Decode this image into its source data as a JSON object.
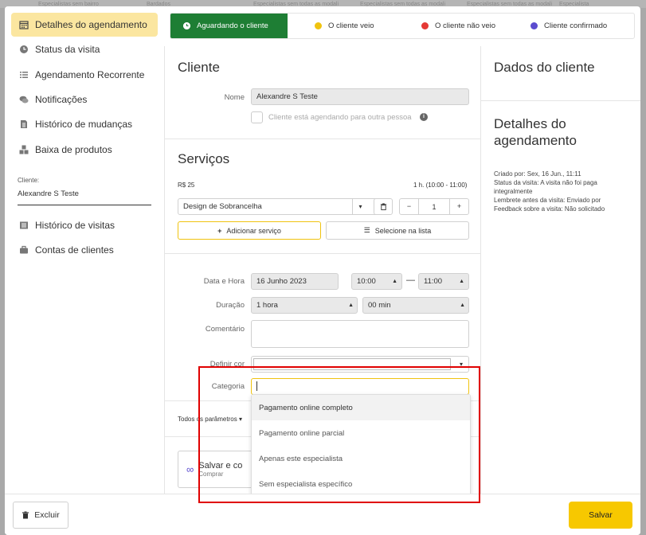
{
  "background_strip": [
    "Especialistas sem bairro",
    "Bardados",
    "Especialistas sem todas as modali",
    "Especialistas sem todas as modali",
    "Especialistas sem todas as modali",
    "Especialista"
  ],
  "sidebar": {
    "items": [
      {
        "label": "Detalhes do agendamento",
        "icon": "calendar-icon",
        "active": true
      },
      {
        "label": "Status da visita",
        "icon": "clock-icon"
      },
      {
        "label": "Agendamento Recorrente",
        "icon": "list-icon"
      },
      {
        "label": "Notificações",
        "icon": "chat-icon"
      },
      {
        "label": "Histórico de mudanças",
        "icon": "document-icon"
      },
      {
        "label": "Baixa de produtos",
        "icon": "boxes-icon"
      }
    ],
    "client_label": "Cliente:",
    "client_name": "Alexandre S Teste",
    "extra_items": [
      {
        "label": "Histórico de visitas",
        "icon": "history-list-icon"
      },
      {
        "label": "Contas de clientes",
        "icon": "briefcase-icon"
      }
    ]
  },
  "status": {
    "tabs": [
      {
        "label": "Aguardando o cliente",
        "color": "#1e7e34",
        "active": true
      },
      {
        "label": "O cliente veio",
        "color": "#f0c30f"
      },
      {
        "label": "O cliente não veio",
        "color": "#e53935"
      },
      {
        "label": "Cliente confirmado",
        "color": "#5b4ccf"
      }
    ]
  },
  "cliente": {
    "title": "Cliente",
    "nome_label": "Nome",
    "nome_value": "Alexandre S Teste",
    "other_person_label": "Cliente está agendando para outra pessoa"
  },
  "servicos": {
    "title": "Serviços",
    "price": "R$ 25",
    "duration": "1 h. (10:00 - 11:00)",
    "service_name": "Design de Sobrancelha",
    "quantity": "1",
    "add_label": "Adicionar serviço",
    "select_label": "Selecione na lista"
  },
  "form": {
    "data_hora_label": "Data e Hora",
    "date_value": "16 Junho 2023",
    "time_start": "10:00",
    "time_end": "11:00",
    "dash": "—",
    "duracao_label": "Duração",
    "duracao_hours": "1 hora",
    "duracao_min": "00 min",
    "comentario_label": "Comentário",
    "cor_label": "Definir cor",
    "categoria_label": "Categoria",
    "categoria_value": "",
    "todos_label": "Todos os parâmetros",
    "salvar_comprar_label": "Salvar e co",
    "comprar_sub": "Comprar"
  },
  "categoria_options": [
    "Pagamento online completo",
    "Pagamento online parcial",
    "Apenas este especialista",
    "Sem especialista específico"
  ],
  "right": {
    "dados_title": "Dados do cliente",
    "detalhes_title": "Detalhes do agendamento",
    "meta": [
      "Criado por: Sex, 16 Jun., 11:11",
      "Status da visita: A visita não foi paga integralmente",
      "Lembrete antes da visita: Enviado por",
      "Feedback sobre a visita: Não solicitado"
    ]
  },
  "footer": {
    "excluir_label": "Excluir",
    "salvar_label": "Salvar"
  }
}
